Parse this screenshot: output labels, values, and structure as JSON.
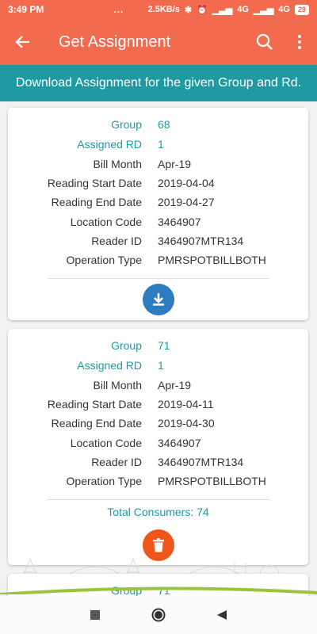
{
  "status_bar": {
    "time": "3:49 PM",
    "dots": "...",
    "speed": "2.5KB/s",
    "net1": "4G",
    "net2": "4G",
    "battery": "29"
  },
  "app_bar": {
    "title": "Get Assignment"
  },
  "banner": {
    "text": "Download Assignment for the given Group and Rd."
  },
  "labels": {
    "group": "Group",
    "assigned_rd": "Assigned RD",
    "bill_month": "Bill Month",
    "reading_start": "Reading Start Date",
    "reading_end": "Reading End Date",
    "location_code": "Location Code",
    "reader_id": "Reader ID",
    "operation_type": "Operation Type"
  },
  "assignments": [
    {
      "group": "68",
      "assigned_rd": "1",
      "bill_month": "Apr-19",
      "reading_start": "2019-04-04",
      "reading_end": "2019-04-27",
      "location_code": "3464907",
      "reader_id": "3464907MTR134",
      "operation_type": "PMRSPOTBILLBOTH",
      "action_icon": "download-icon"
    },
    {
      "group": "71",
      "assigned_rd": "1",
      "bill_month": "Apr-19",
      "reading_start": "2019-04-11",
      "reading_end": "2019-04-30",
      "location_code": "3464907",
      "reader_id": "3464907MTR134",
      "operation_type": "PMRSPOTBILLBOTH",
      "total_consumers": "Total Consumers: 74",
      "action_icon": "delete-icon"
    },
    {
      "group": "71"
    }
  ],
  "colors": {
    "primary": "#f26b4f",
    "teal": "#1f9aa3",
    "download": "#2e7bbf",
    "delete": "#f0551a"
  }
}
